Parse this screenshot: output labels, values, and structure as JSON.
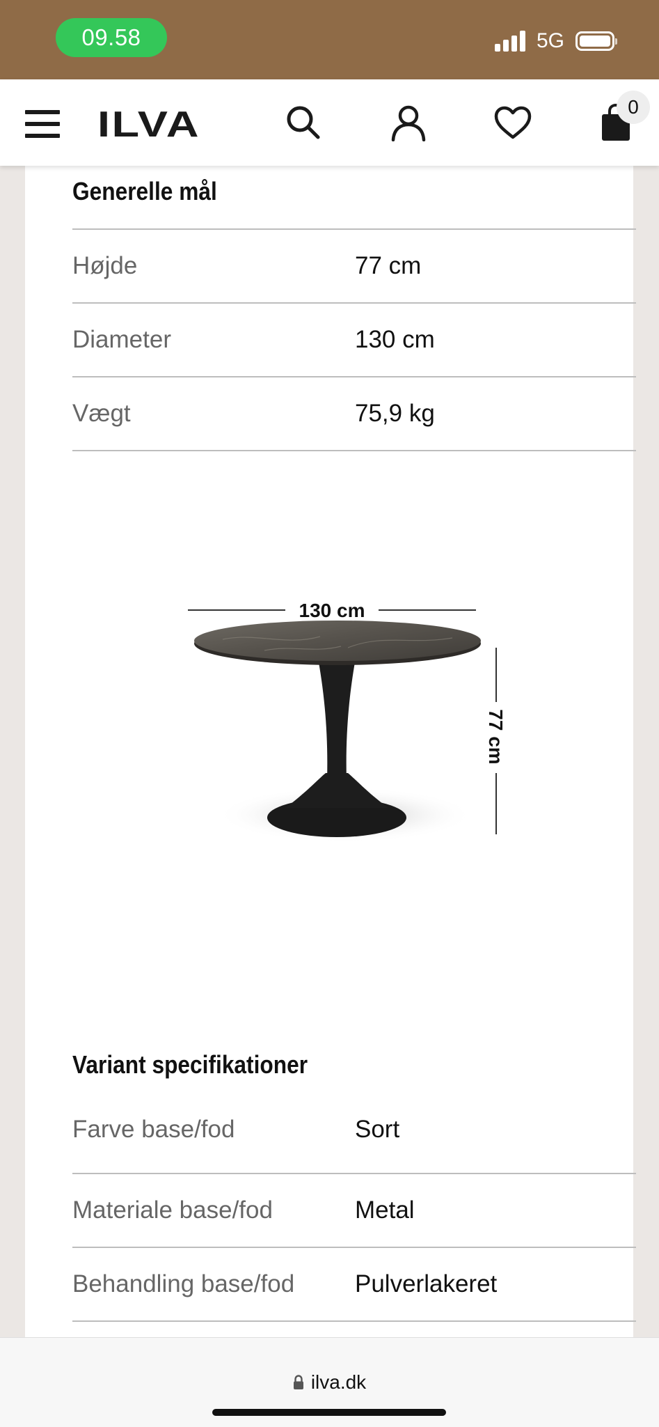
{
  "status_bar": {
    "time": "09.58",
    "network": "5G"
  },
  "header": {
    "brand": "ILVA",
    "cart_count": "0"
  },
  "general_dimensions": {
    "title": "Generelle mål",
    "rows": [
      {
        "label": "Højde",
        "value": "77 cm"
      },
      {
        "label": "Diameter",
        "value": "130 cm"
      },
      {
        "label": "Vægt",
        "value": "75,9 kg"
      }
    ]
  },
  "illustration": {
    "width_label": "130 cm",
    "height_label": "77 cm"
  },
  "variant_specs": {
    "title": "Variant specifikationer",
    "rows": [
      {
        "label": "Farve base/fod",
        "value": "Sort"
      },
      {
        "label": "Materiale base/fod",
        "value": "Metal"
      },
      {
        "label": "Behandling base/fod",
        "value": "Pulverlakeret"
      }
    ]
  },
  "browser": {
    "url": "ilva.dk"
  },
  "colors": {
    "status_bar_bg": "#8f6b47",
    "time_pill": "#34c759"
  },
  "icons": [
    "menu-icon",
    "search-icon",
    "account-icon",
    "heart-icon",
    "bag-icon",
    "lock-icon"
  ]
}
